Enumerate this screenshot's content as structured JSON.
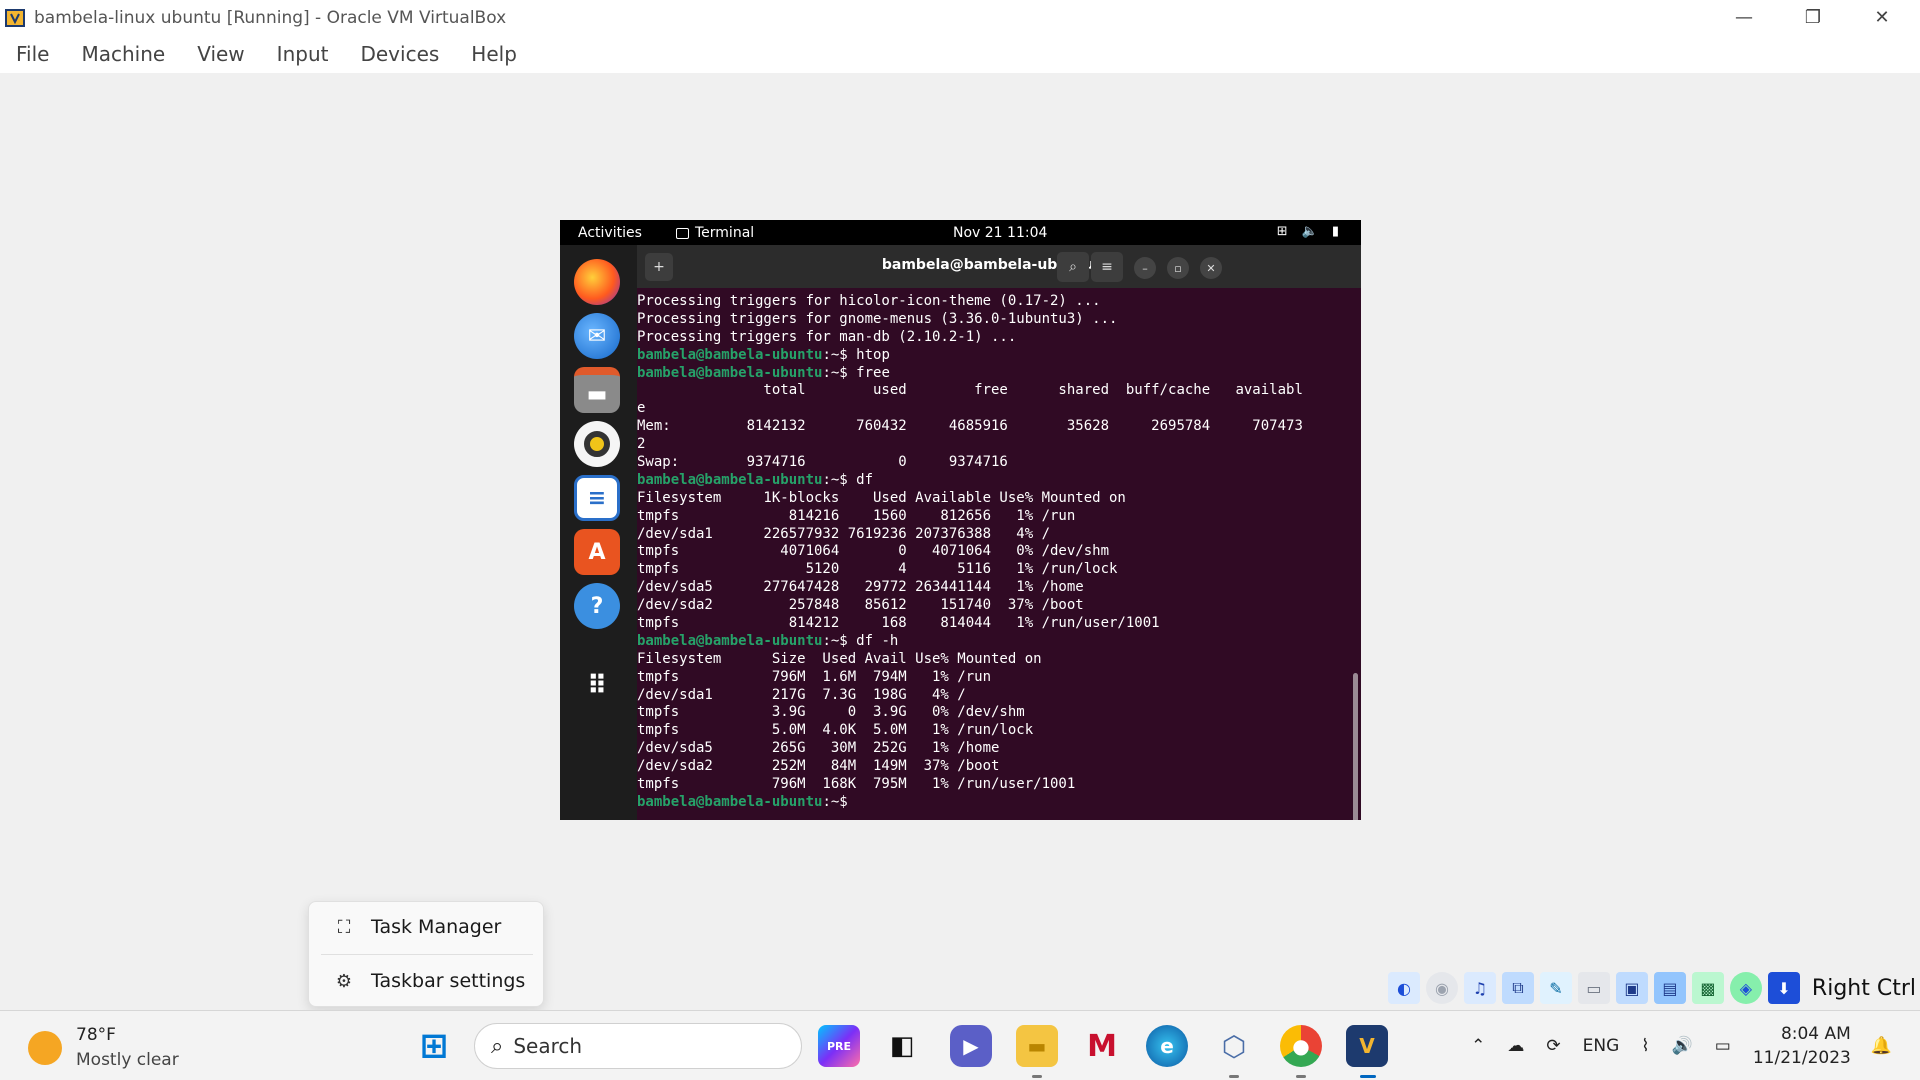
{
  "host": {
    "window_title": "bambela-linux ubuntu [Running] - Oracle VM VirtualBox",
    "menu": [
      "File",
      "Machine",
      "View",
      "Input",
      "Devices",
      "Help"
    ],
    "controls": {
      "minimize": "—",
      "restore": "❐",
      "close": "✕"
    }
  },
  "gnome": {
    "activities": "Activities",
    "app": "Terminal",
    "clock": "Nov 21  11:04",
    "tray_icons": [
      "network-icon",
      "volume-icon",
      "battery-icon"
    ]
  },
  "dock": {
    "apps": [
      "firefox",
      "thunderbird",
      "files",
      "rhythmbox",
      "writer",
      "software",
      "help",
      "show-apps"
    ]
  },
  "terminal": {
    "title": "bambela@bambela-ubuntu: ~",
    "prompt": "bambela@bambela-ubuntu:~$",
    "lines": [
      {
        "t": "out",
        "text": "Processing triggers for hicolor-icon-theme (0.17-2) ..."
      },
      {
        "t": "out",
        "text": "Processing triggers for gnome-menus (3.36.0-1ubuntu3) ..."
      },
      {
        "t": "out",
        "text": "Processing triggers for man-db (2.10.2-1) ..."
      },
      {
        "t": "cmd",
        "text": " htop"
      },
      {
        "t": "cmd",
        "text": " free"
      },
      {
        "t": "out",
        "text": "               total        used        free      shared  buff/cache   availabl"
      },
      {
        "t": "out",
        "text": "e"
      },
      {
        "t": "out",
        "text": "Mem:         8142132      760432     4685916       35628     2695784     707473"
      },
      {
        "t": "out",
        "text": "2"
      },
      {
        "t": "out",
        "text": "Swap:        9374716           0     9374716"
      },
      {
        "t": "cmd",
        "text": " df"
      },
      {
        "t": "out",
        "text": "Filesystem     1K-blocks    Used Available Use% Mounted on"
      },
      {
        "t": "out",
        "text": "tmpfs             814216    1560    812656   1% /run"
      },
      {
        "t": "out",
        "text": "/dev/sda1      226577932 7619236 207376388   4% /"
      },
      {
        "t": "out",
        "text": "tmpfs            4071064       0   4071064   0% /dev/shm"
      },
      {
        "t": "out",
        "text": "tmpfs               5120       4      5116   1% /run/lock"
      },
      {
        "t": "out",
        "text": "/dev/sda5      277647428   29772 263441144   1% /home"
      },
      {
        "t": "out",
        "text": "/dev/sda2         257848   85612    151740  37% /boot"
      },
      {
        "t": "out",
        "text": "tmpfs             814212     168    814044   1% /run/user/1001"
      },
      {
        "t": "cmd",
        "text": " df -h"
      },
      {
        "t": "out",
        "text": "Filesystem      Size  Used Avail Use% Mounted on"
      },
      {
        "t": "out",
        "text": "tmpfs           796M  1.6M  794M   1% /run"
      },
      {
        "t": "out",
        "text": "/dev/sda1       217G  7.3G  198G   4% /"
      },
      {
        "t": "out",
        "text": "tmpfs           3.9G     0  3.9G   0% /dev/shm"
      },
      {
        "t": "out",
        "text": "tmpfs           5.0M  4.0K  5.0M   1% /run/lock"
      },
      {
        "t": "out",
        "text": "/dev/sda5       265G   30M  252G   1% /home"
      },
      {
        "t": "out",
        "text": "/dev/sda2       252M   84M  149M  37% /boot"
      },
      {
        "t": "out",
        "text": "tmpfs           796M  168K  795M   1% /run/user/1001"
      },
      {
        "t": "cmd",
        "text": " "
      }
    ]
  },
  "context_menu": {
    "items": [
      {
        "label": "Task Manager",
        "icon": "task-manager-icon"
      },
      {
        "label": "Taskbar settings",
        "icon": "gear-icon"
      }
    ]
  },
  "vbox_status": {
    "host_key": "Right Ctrl"
  },
  "taskbar": {
    "weather_temp": "78°F",
    "weather_desc": "Mostly clear",
    "search_placeholder": "Search",
    "language": "ENG",
    "time": "8:04 AM",
    "date": "11/21/2023"
  }
}
